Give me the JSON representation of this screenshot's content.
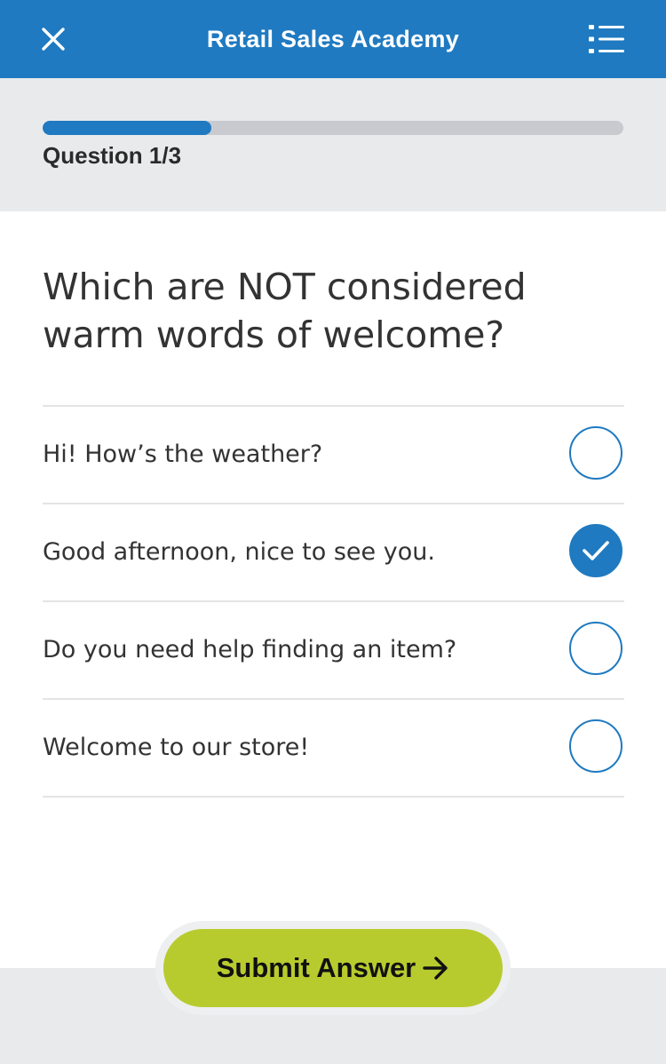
{
  "header": {
    "title": "Retail Sales Academy",
    "close_icon": "close-icon",
    "menu_icon": "list-menu-icon",
    "bar_color": "#1f7ac1"
  },
  "progress": {
    "label": "Question 1/3",
    "fraction": 0.29,
    "fill_color": "#1f7ac1"
  },
  "question": {
    "text": "Which are NOT considered warm words of welcome?"
  },
  "options": [
    {
      "label": "Hi! How’s the weather?",
      "selected": false
    },
    {
      "label": "Good afternoon, nice to see you.",
      "selected": true
    },
    {
      "label": "Do you need help finding an item?",
      "selected": false
    },
    {
      "label": "Welcome to our store!",
      "selected": false
    }
  ],
  "submit": {
    "label": "Submit Answer",
    "icon": "arrow-right-icon",
    "color": "#b8cb2e"
  }
}
